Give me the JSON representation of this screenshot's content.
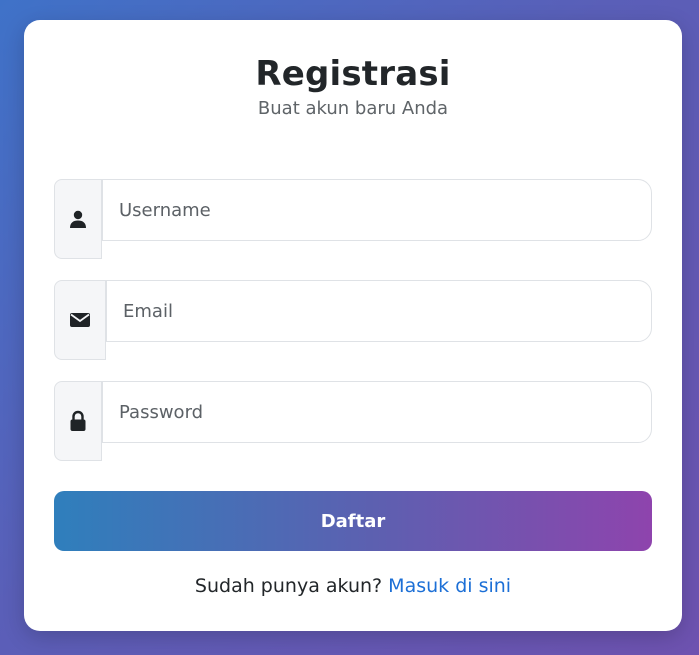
{
  "card": {
    "title": "Registrasi",
    "subtitle": "Buat akun baru Anda"
  },
  "form": {
    "username": {
      "placeholder": "Username",
      "icon": "user-icon"
    },
    "email": {
      "placeholder": "Email",
      "icon": "envelope-icon"
    },
    "password": {
      "placeholder": "Password",
      "icon": "lock-icon"
    },
    "submit_label": "Daftar"
  },
  "footer": {
    "prompt": "Sudah punya akun?",
    "link_label": "Masuk di sini"
  },
  "colors": {
    "button_gradient_start": "#2f7fbc",
    "button_gradient_end": "#8e44ad",
    "link": "#1c6fd6"
  }
}
